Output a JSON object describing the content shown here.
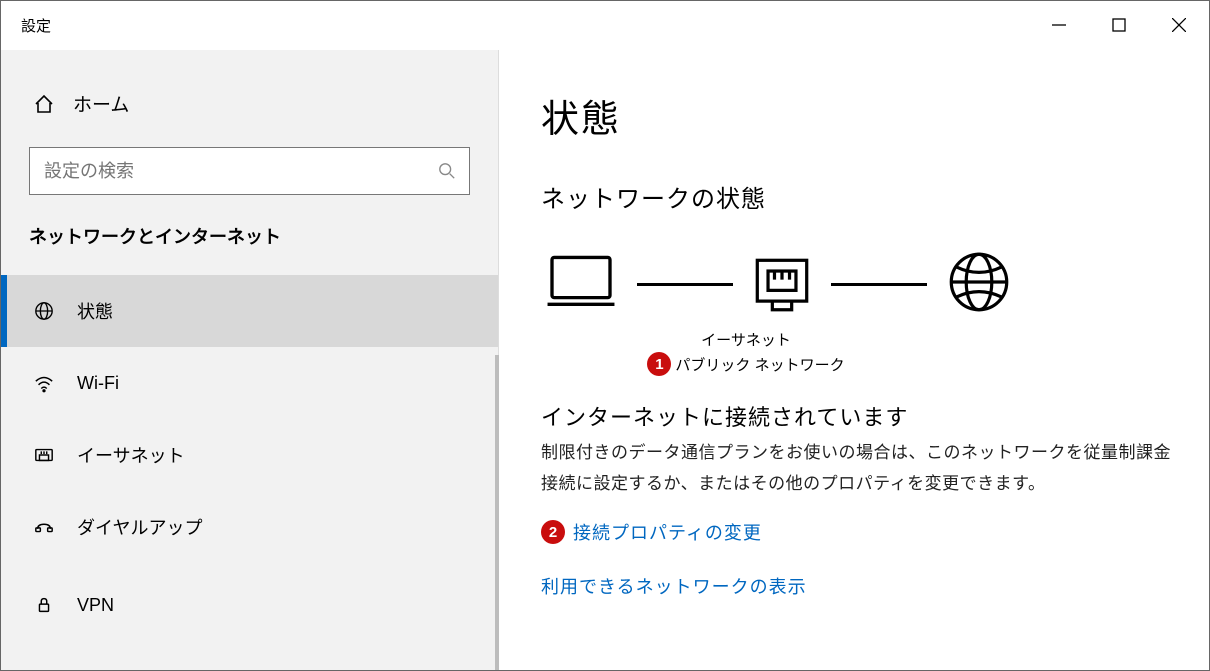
{
  "window": {
    "title": "設定"
  },
  "sidebar": {
    "home": "ホーム",
    "search_placeholder": "設定の検索",
    "section_heading": "ネットワークとインターネット",
    "items": [
      {
        "label": "状態",
        "icon": "globe"
      },
      {
        "label": "Wi-Fi",
        "icon": "wifi"
      },
      {
        "label": "イーサネット",
        "icon": "ethernet"
      },
      {
        "label": "ダイヤルアップ",
        "icon": "dialup"
      },
      {
        "label": "VPN",
        "icon": "vpn"
      }
    ]
  },
  "main": {
    "title": "状態",
    "subheading": "ネットワークの状態",
    "diagram": {
      "network_name": "イーサネット",
      "network_type": "パブリック ネットワーク"
    },
    "connected_heading": "インターネットに接続されています",
    "connected_desc": "制限付きのデータ通信プランをお使いの場合は、このネットワークを従量制課金接続に設定するか、またはその他のプロパティを変更できます。",
    "link_change_props": "接続プロパティの変更",
    "link_show_networks": "利用できるネットワークの表示"
  },
  "annotations": {
    "one": "1",
    "two": "2"
  }
}
